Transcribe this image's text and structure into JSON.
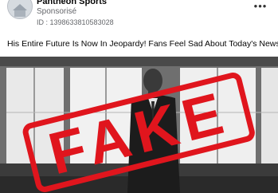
{
  "post": {
    "page_name": "Pantheon Sports",
    "sponsored_label": "Sponsorisé",
    "id_line": "ID : 1398633810583028",
    "more_icon": "more-horizontal-icon",
    "text": "His Entire Future Is Now In Jeopardy! Fans Feel Sad About Today's News."
  },
  "image": {
    "stamp_text": "FAKE",
    "stamp_color": "#e0151d"
  }
}
